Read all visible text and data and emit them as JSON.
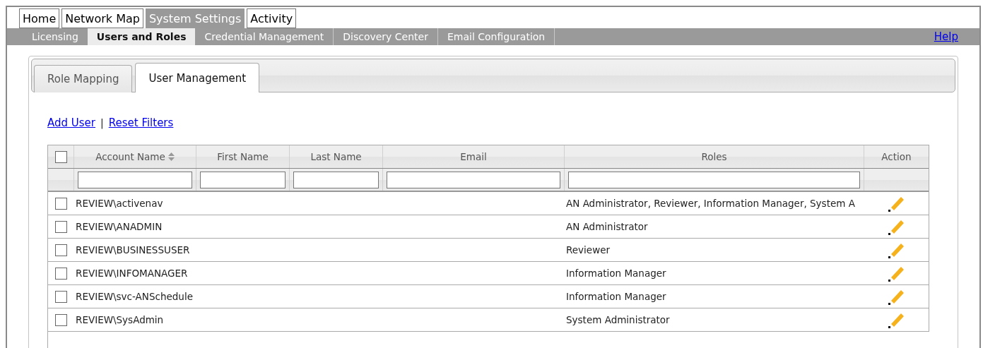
{
  "top_tabs": [
    {
      "label": "Home",
      "selected": false
    },
    {
      "label": "Network Map",
      "selected": false
    },
    {
      "label": "System Settings",
      "selected": true
    },
    {
      "label": "Activity",
      "selected": false
    }
  ],
  "sub_nav": {
    "items": [
      {
        "label": "Licensing",
        "selected": false
      },
      {
        "label": "Users and Roles",
        "selected": true
      },
      {
        "label": "Credential Management",
        "selected": false
      },
      {
        "label": "Discovery Center",
        "selected": false
      },
      {
        "label": "Email Configuration",
        "selected": false
      }
    ],
    "help": "Help"
  },
  "panel_tabs": [
    {
      "label": "Role Mapping",
      "selected": false
    },
    {
      "label": "User Management",
      "selected": true
    }
  ],
  "actions": {
    "add": "Add User",
    "separator": "|",
    "reset": "Reset Filters"
  },
  "table": {
    "select_all": {
      "checked": false
    },
    "columns": [
      {
        "label": "Account Name",
        "sorted": true,
        "filter": true
      },
      {
        "label": "First Name",
        "sorted": false,
        "filter": true
      },
      {
        "label": "Last Name",
        "sorted": false,
        "filter": true
      },
      {
        "label": "Email",
        "sorted": false,
        "filter": true
      },
      {
        "label": "Roles",
        "sorted": false,
        "filter": true
      },
      {
        "label": "Action",
        "sorted": false,
        "filter": false
      }
    ],
    "rows": [
      {
        "checked": false,
        "account": "REVIEW\\activenav",
        "roles": "AN Administrator, Reviewer, Information Manager, System A"
      },
      {
        "checked": false,
        "account": "REVIEW\\ANADMIN",
        "roles": "AN Administrator"
      },
      {
        "checked": false,
        "account": "REVIEW\\BUSINESSUSER",
        "roles": "Reviewer"
      },
      {
        "checked": false,
        "account": "REVIEW\\INFOMANAGER",
        "roles": "Information Manager"
      },
      {
        "checked": false,
        "account": "REVIEW\\svc-ANSchedule",
        "roles": "Information Manager"
      },
      {
        "checked": false,
        "account": "REVIEW\\SysAdmin",
        "roles": "System Administrator"
      }
    ]
  }
}
